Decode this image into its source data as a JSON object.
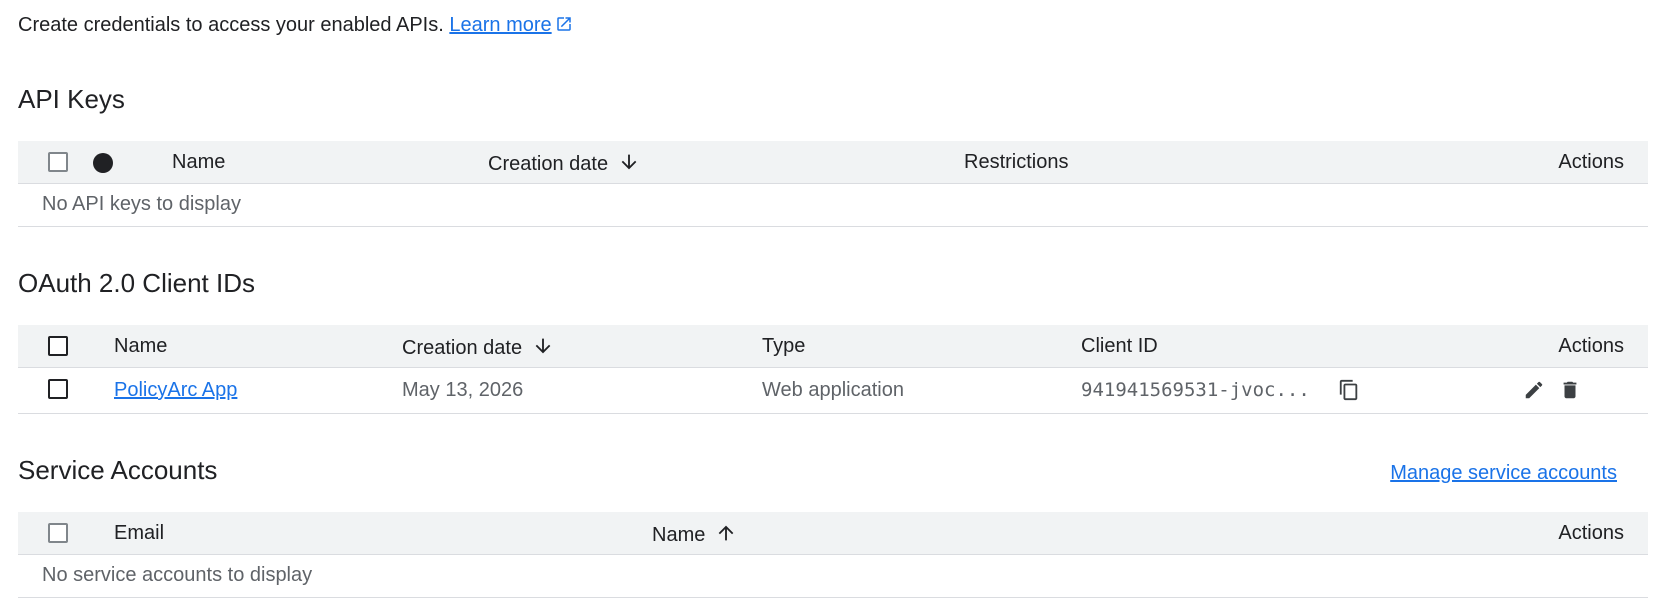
{
  "intro": {
    "text": "Create credentials to access your enabled APIs.",
    "link_label": "Learn more"
  },
  "api_keys": {
    "title": "API Keys",
    "columns": {
      "name": "Name",
      "creation_date": "Creation date",
      "restrictions": "Restrictions",
      "actions": "Actions"
    },
    "empty_text": "No API keys to display"
  },
  "oauth": {
    "title": "OAuth 2.0 Client IDs",
    "columns": {
      "name": "Name",
      "creation_date": "Creation date",
      "type": "Type",
      "client_id": "Client ID",
      "actions": "Actions"
    },
    "rows": [
      {
        "name": "PolicyArc App",
        "creation_date": "May 13, 2026",
        "type": "Web application",
        "client_id": "941941569531-jvoc..."
      }
    ]
  },
  "service_accounts": {
    "title": "Service Accounts",
    "manage_link": "Manage service accounts",
    "columns": {
      "email": "Email",
      "name": "Name",
      "actions": "Actions"
    },
    "empty_text": "No service accounts to display"
  },
  "colors": {
    "link": "#1a73e8",
    "header_bg": "#f1f3f4",
    "divider": "#dadce0"
  }
}
